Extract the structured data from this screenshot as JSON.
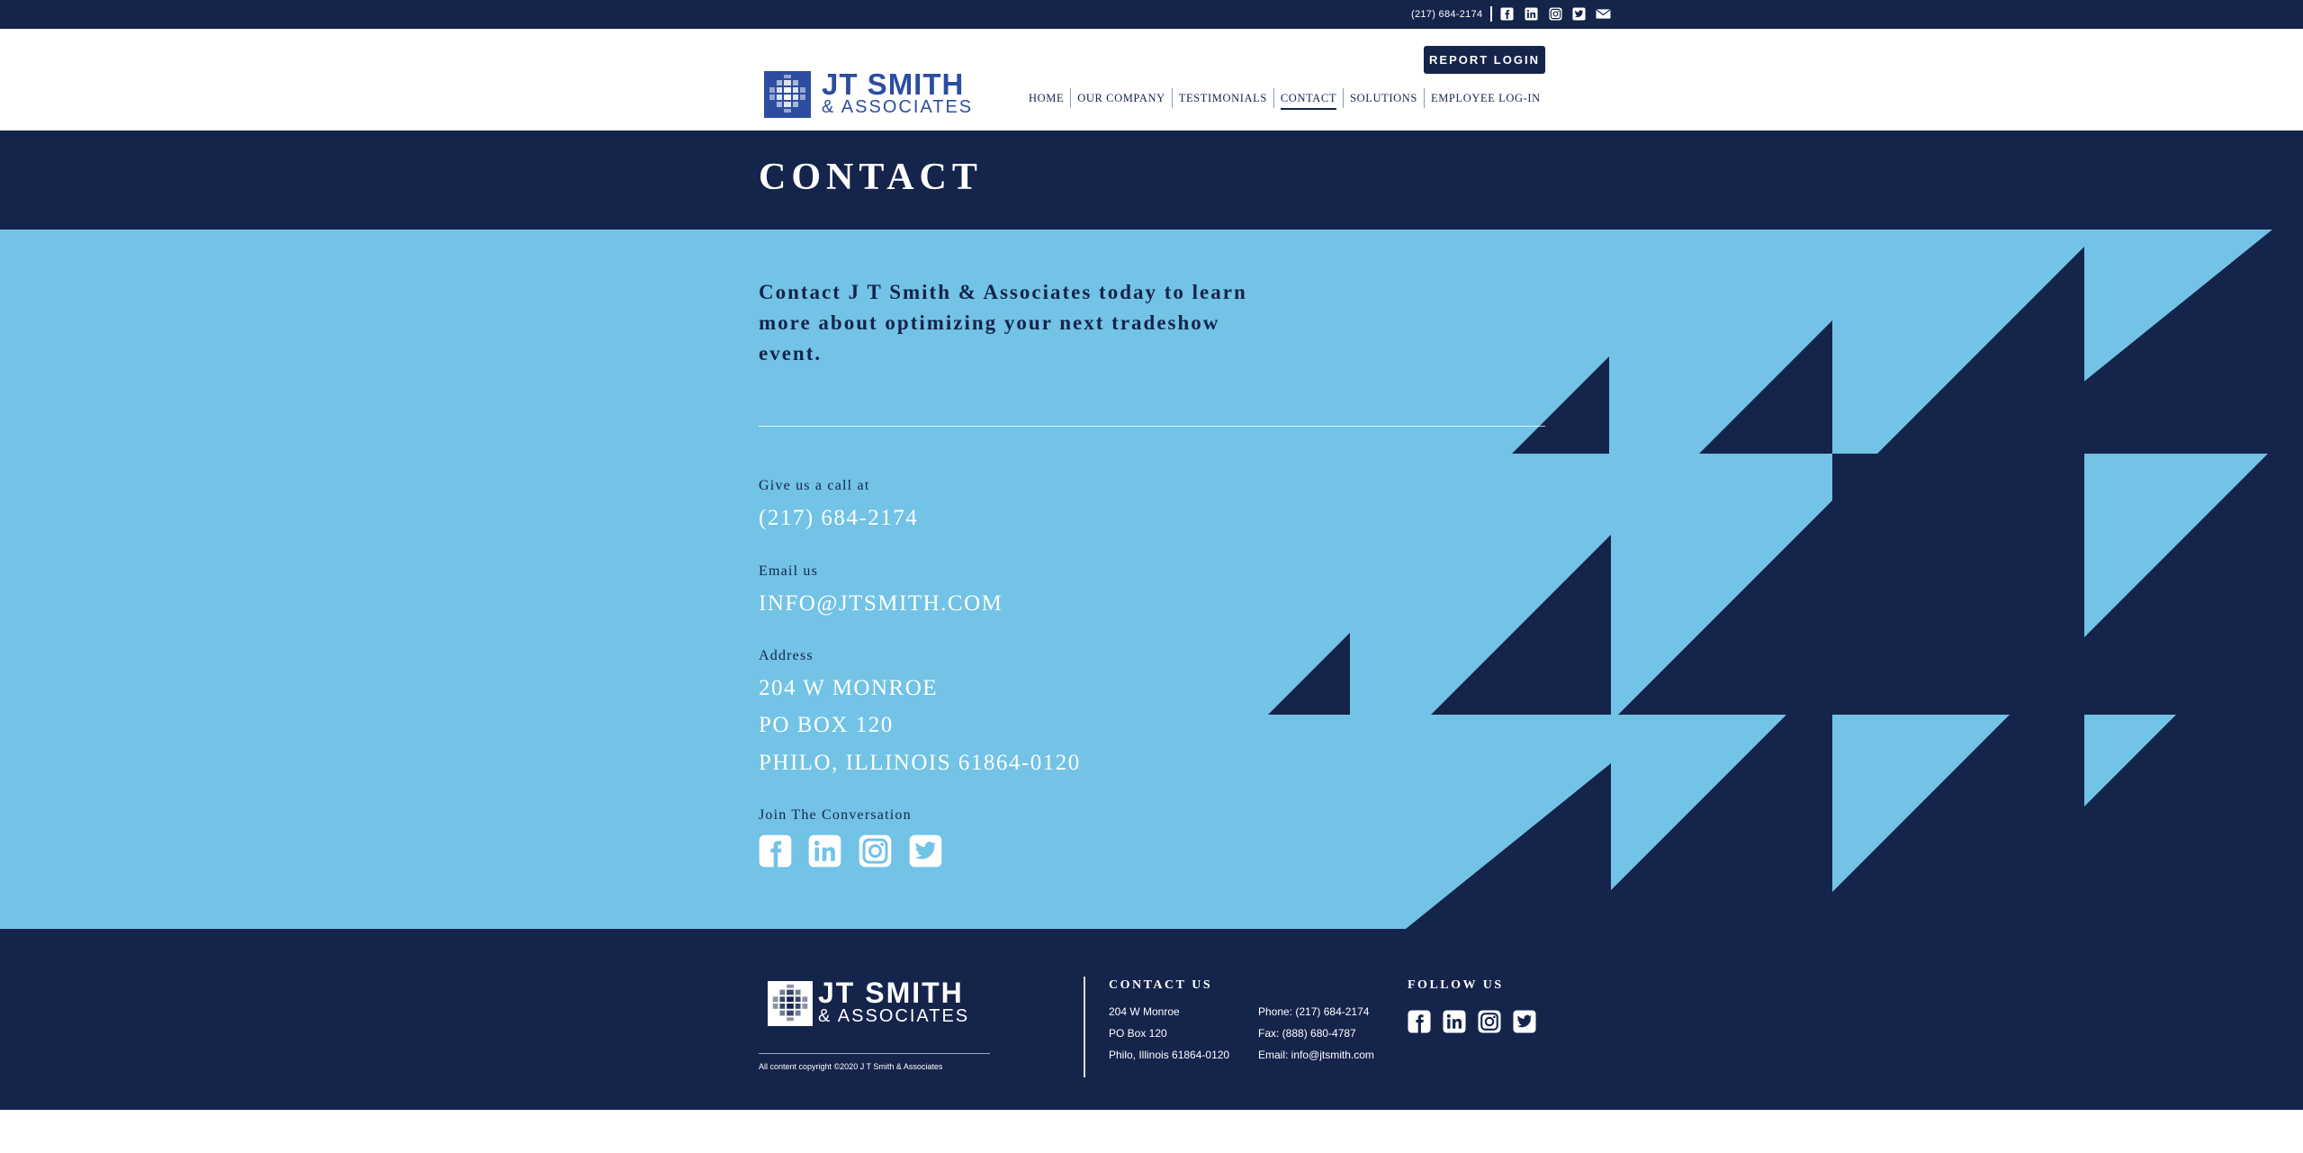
{
  "topbar": {
    "phone": "(217) 684-2174",
    "icons": [
      "facebook-icon",
      "linkedin-icon",
      "instagram-icon",
      "twitter-icon",
      "mail-icon"
    ]
  },
  "logo": {
    "line1": "JT SMITH",
    "line2": "& ASSOCIATES"
  },
  "header": {
    "report_login": "REPORT LOGIN"
  },
  "nav": {
    "items": [
      {
        "label": "HOME"
      },
      {
        "label": "OUR COMPANY"
      },
      {
        "label": "TESTIMONIALS"
      },
      {
        "label": "CONTACT"
      },
      {
        "label": "SOLUTIONS"
      },
      {
        "label": "EMPLOYEE LOG-IN"
      }
    ],
    "active": "CONTACT"
  },
  "banner": {
    "title": "CONTACT"
  },
  "main": {
    "intro": "Contact J T Smith & Associates today to learn more about optimizing your next tradeshow event.",
    "call_label": "Give us a call at",
    "phone": "(217) 684-2174",
    "email_label": "Email us",
    "email": "INFO@JTSMITH.COM",
    "address_label": "Address",
    "address": [
      "204 W MONROE",
      "PO BOX 120",
      "PHILO, ILLINOIS 61864-0120"
    ],
    "social_label": "Join The Conversation",
    "social_icons": [
      "facebook-icon",
      "linkedin-icon",
      "instagram-icon",
      "twitter-icon"
    ]
  },
  "footer": {
    "copyright": "All content copyright ©2020 J T Smith & Associates",
    "contact_heading": "CONTACT US",
    "address": [
      "204 W Monroe",
      "PO Box 120",
      "Philo, Illinois 61864-0120"
    ],
    "phone": "Phone: (217) 684-2174",
    "fax": "Fax: (888) 680-4787",
    "email": "Email: info@jtsmith.com",
    "follow_heading": "FOLLOW US"
  },
  "colors": {
    "navy": "#15244b",
    "light_blue": "#72c3e5",
    "logo_blue": "#2c4da0",
    "white": "#ffffff"
  }
}
